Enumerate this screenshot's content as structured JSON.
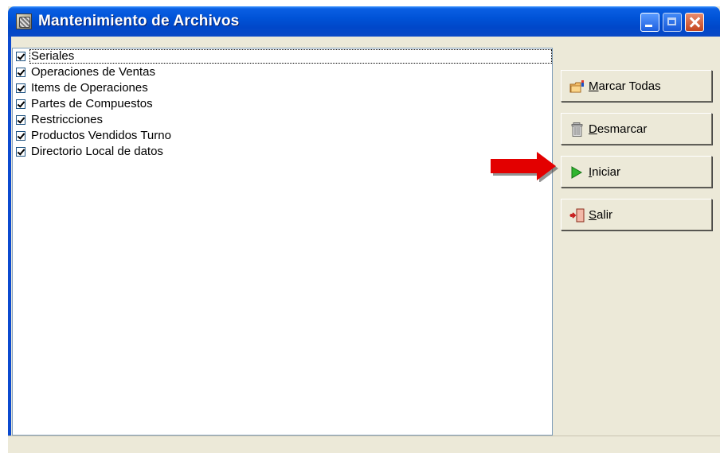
{
  "window": {
    "title": "Mantenimiento de Archivos"
  },
  "list": {
    "items": [
      {
        "label": "Seriales",
        "checked": true
      },
      {
        "label": "Operaciones de Ventas",
        "checked": true
      },
      {
        "label": "Items de Operaciones",
        "checked": true
      },
      {
        "label": "Partes de Compuestos",
        "checked": true
      },
      {
        "label": "Restricciones",
        "checked": true
      },
      {
        "label": "Productos Vendidos Turno",
        "checked": true
      },
      {
        "label": "Directorio Local de datos",
        "checked": true
      }
    ]
  },
  "buttons": {
    "marcar": {
      "first": "M",
      "rest": "arcar Todas",
      "icon": "folder-flag-icon"
    },
    "desmarcar": {
      "first": "D",
      "rest": "esmarcar",
      "icon": "trash-icon"
    },
    "iniciar": {
      "first": "I",
      "rest": "niciar",
      "icon": "play-icon"
    },
    "salir": {
      "first": "S",
      "rest": "alir",
      "icon": "exit-door-icon"
    }
  },
  "annotation": {
    "icon": "red-arrow-icon",
    "color": "#e30000"
  }
}
